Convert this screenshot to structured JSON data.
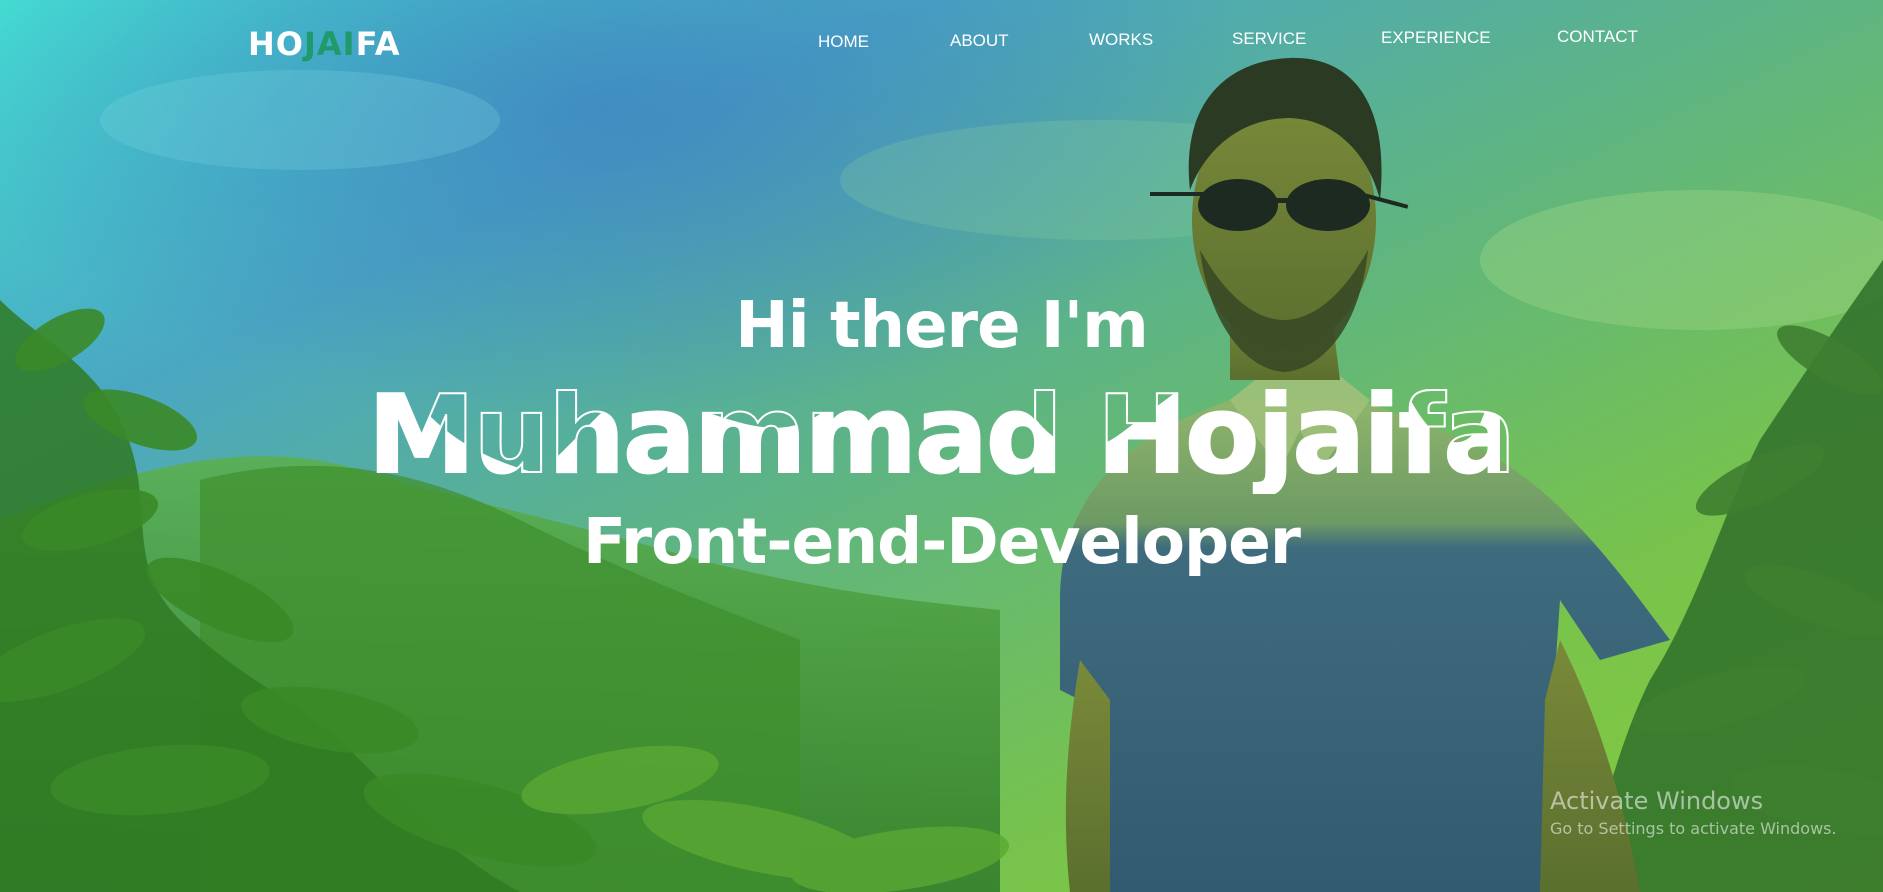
{
  "brand": {
    "logo_part1": "HO",
    "logo_accent": "JAI",
    "logo_part2": "FA",
    "accent_color": "#1f9a6a"
  },
  "nav": {
    "items": [
      {
        "label": "HOME"
      },
      {
        "label": "ABOUT"
      },
      {
        "label": "WORKS"
      },
      {
        "label": "SERVICE"
      },
      {
        "label": "EXPERIENCE"
      },
      {
        "label": "CONTACT"
      }
    ]
  },
  "hero": {
    "greeting": "Hi there I'm",
    "name": "Muhammad Hojaifa",
    "role": "Front-end-Developer",
    "image_semantic": "person-photo-outdoor-landscape"
  },
  "watermark": {
    "title": "Activate Windows",
    "subtitle": "Go to Settings to activate Windows."
  },
  "colors": {
    "gradient_top_left": "#3fd6d2",
    "gradient_mid": "#5aa0c8",
    "gradient_right": "#7ac84a",
    "foliage": "#4a9a2a"
  }
}
